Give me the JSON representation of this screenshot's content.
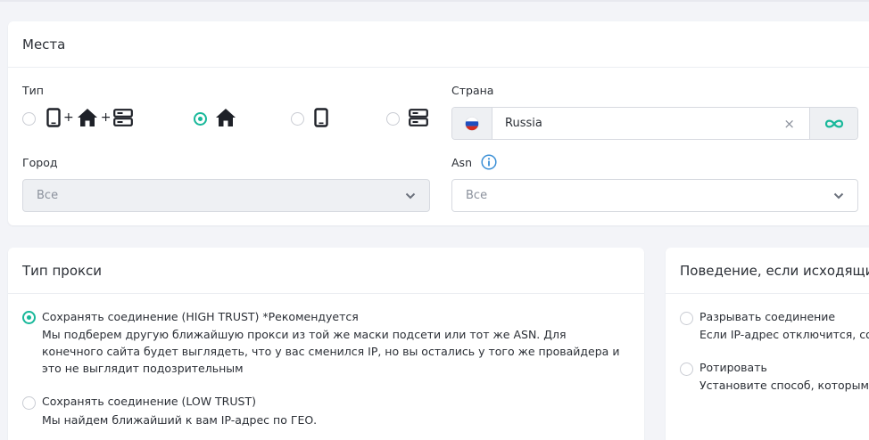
{
  "places": {
    "title": "Места",
    "type_label": "Тип",
    "type_options": [
      {
        "name": "mobile+residential+datacenter",
        "selected": false
      },
      {
        "name": "residential",
        "selected": true
      },
      {
        "name": "mobile",
        "selected": false
      },
      {
        "name": "datacenter",
        "selected": false
      }
    ],
    "plus": "+",
    "country_label": "Страна",
    "country_value": "Russia",
    "clear_symbol": "×",
    "city_label": "Город",
    "city_value": "Все",
    "asn_label": "Asn",
    "asn_value": "Все"
  },
  "proxy_type": {
    "title": "Тип прокси",
    "options": [
      {
        "title": "Сохранять соединение (HIGH TRUST) *Рекомендуется",
        "desc": "Мы подберем другую ближайшую прокси из той же маски подсети или тот же ASN. Для конечного сайта будет выглядеть, что у вас сменился IP, но вы остались у того же провайдера и это не выглядит подозрительным",
        "selected": true
      },
      {
        "title": "Сохранять соединение (LOW TRUST)",
        "desc": "Мы найдем ближайший к вам IP-адрес по ГЕО.",
        "selected": false
      }
    ]
  },
  "behavior": {
    "title": "Поведение, если исходящий",
    "options": [
      {
        "title": "Разрывать соединение",
        "desc": "Если IP-адрес отключится, соед",
        "selected": false
      },
      {
        "title": "Ротировать",
        "desc": "Установите способ, которым вы",
        "selected": false
      }
    ]
  },
  "colors": {
    "accent": "#18b89a",
    "info": "#3b8fd6",
    "background": "#f3f4f8",
    "card": "#ffffff"
  }
}
